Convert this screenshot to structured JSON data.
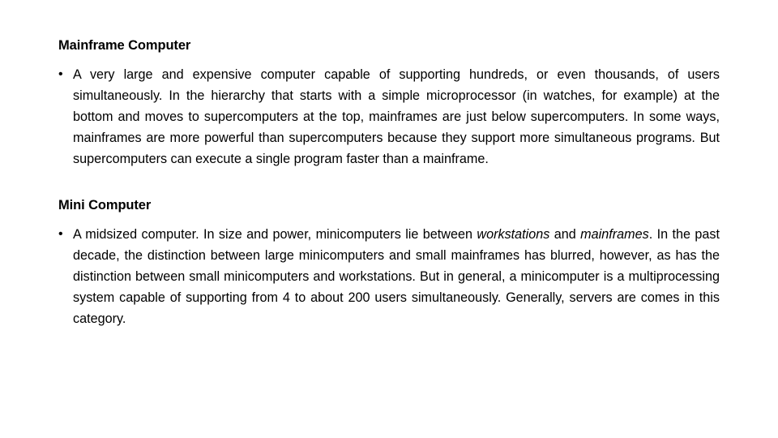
{
  "slide": {
    "background_color": "#ffffff",
    "text_color": "#000000",
    "sections": [
      {
        "heading": "Mainframe Computer",
        "bullet_marker": "•",
        "body_parts": [
          {
            "text": "A very large and expensive computer capable of supporting hundreds, or even thousands, of users simultaneously. In the hierarchy that starts with a simple microprocessor (in watches, for example) at the bottom and moves to supercomputers at the top, mainframes are just below supercomputers. In some ways, mainframes are more powerful than supercomputers because they support more simultaneous programs. But supercomputers can execute a single program faster than a mainframe.",
            "style": "normal"
          }
        ]
      },
      {
        "heading": "Mini Computer",
        "bullet_marker": "•",
        "body_parts": [
          {
            "text": "A midsized computer. In size and power, minicomputers lie between ",
            "style": "normal"
          },
          {
            "text": "workstations",
            "style": "italic"
          },
          {
            "text": " and ",
            "style": "normal"
          },
          {
            "text": "mainframes",
            "style": "italic"
          },
          {
            "text": ". In the past decade, the distinction between large minicomputers and small mainframes has blurred, however, as has the distinction between small minicomputers and workstations. But in general, a minicomputer is a multiprocessing system capable of supporting from 4 to about 200 users simultaneously. Generally, servers are comes in this category.",
            "style": "normal"
          }
        ]
      }
    ]
  }
}
